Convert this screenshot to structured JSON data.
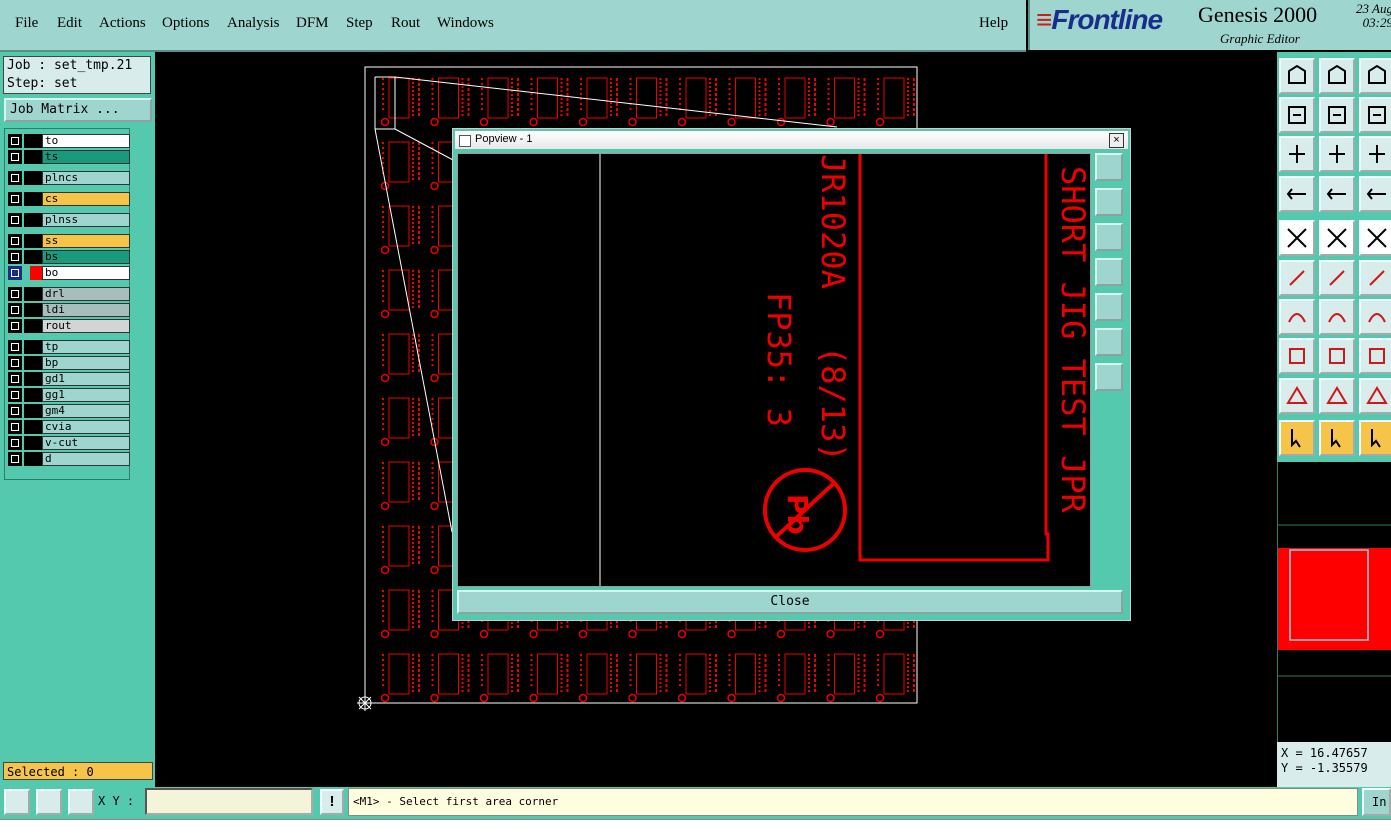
{
  "menu": {
    "items": [
      "File",
      "Edit",
      "Actions",
      "Options",
      "Analysis",
      "DFM",
      "Step",
      "Rout",
      "Windows"
    ],
    "help": "Help"
  },
  "brand": {
    "logo": "Frontline",
    "product": "Genesis 2000",
    "subtitle": "Graphic Editor",
    "date": "23 Aug",
    "time": "03:29"
  },
  "job": {
    "job_line": "Job : set_tmp.21",
    "step_line": "Step: set",
    "matrix_button": "Job Matrix ..."
  },
  "layers": [
    {
      "name": "to",
      "color": "#ffffff",
      "active": false
    },
    {
      "name": "ts",
      "color": "#1a9a7c",
      "active": false
    },
    {
      "name": "plncs",
      "color": "#9ed6cf",
      "active": false
    },
    {
      "name": "cs",
      "color": "#f7c44a",
      "active": false
    },
    {
      "name": "plnss",
      "color": "#9ed6cf",
      "active": false
    },
    {
      "name": "ss",
      "color": "#f7c44a",
      "active": false
    },
    {
      "name": "bs",
      "color": "#1a9a7c",
      "active": false
    },
    {
      "name": "bo",
      "color": "#ffffff",
      "active": true
    },
    {
      "name": "drl",
      "color": "#a9bdbd",
      "active": false
    },
    {
      "name": "ldi",
      "color": "#a9bdbd",
      "active": false
    },
    {
      "name": "rout",
      "color": "#d4d4d4",
      "active": false
    },
    {
      "name": "tp",
      "color": "#9ed6cf",
      "active": false
    },
    {
      "name": "bp",
      "color": "#9ed6cf",
      "active": false
    },
    {
      "name": "gd1",
      "color": "#9ed6cf",
      "active": false
    },
    {
      "name": "gg1",
      "color": "#9ed6cf",
      "active": false
    },
    {
      "name": "gm4",
      "color": "#9ed6cf",
      "active": false
    },
    {
      "name": "cvia",
      "color": "#9ed6cf",
      "active": false
    },
    {
      "name": "v-cut",
      "color": "#9ed6cf",
      "active": false
    },
    {
      "name": "d",
      "color": "#9ed6cf",
      "active": false
    }
  ],
  "selected": "Selected : 0",
  "popview": {
    "title": "Popview - 1",
    "close_label": "Close",
    "board_text_1": "SHORT JIG TEST JPR",
    "board_text_2": "JR1020A",
    "board_text_3": "FP35: 3",
    "board_text_4": "(8/13)"
  },
  "coords": {
    "x": "X =  16.47657",
    "y": "Y = -1.35579"
  },
  "bottom": {
    "xy_label": "X Y :",
    "xy_value": "",
    "bang": "!",
    "prompt": "<M1> - Select first area corner",
    "in_label": "In"
  },
  "colors": {
    "panel": "#55c9ad",
    "menu": "#9ed6cf",
    "highlight": "#f7c44a",
    "feature": "#ff0000"
  }
}
